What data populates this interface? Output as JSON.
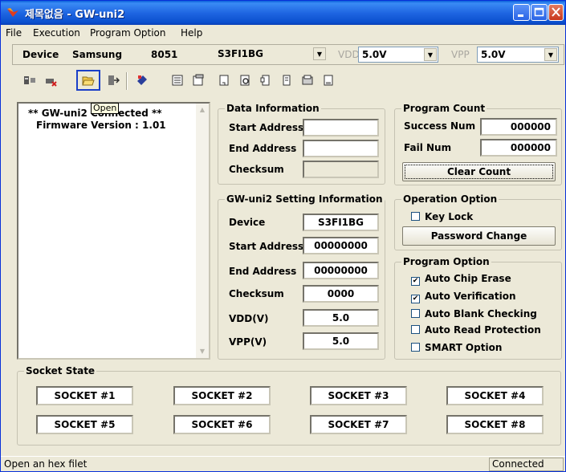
{
  "window": {
    "title": "제목없음 - GW-uni2"
  },
  "menu": {
    "file": "File",
    "execution": "Execution",
    "program_option": "Program Option",
    "help": "Help"
  },
  "device_bar": {
    "device_label": "Device",
    "maker": "Samsung",
    "core": "8051",
    "chip": "S3FI1BG",
    "vdd_label": "VDD",
    "vdd_value": "5.0V",
    "vpp_label": "VPP",
    "vpp_value": "5.0V"
  },
  "toolbar": {
    "tooltip": "Open",
    "active_tool": "open-icon"
  },
  "log": {
    "line1": "** GW-uni2 Connected **",
    "line2": "Firmware Version : 1.01"
  },
  "data_info": {
    "title": "Data Information",
    "start_label": "Start Address",
    "start_value": "",
    "end_label": "End Address",
    "end_value": "",
    "checksum_label": "Checksum",
    "checksum_value": ""
  },
  "setting_info": {
    "title": "GW-uni2 Setting Information",
    "device_label": "Device",
    "device_value": "S3FI1BG",
    "start_label": "Start Address",
    "start_value": "00000000",
    "end_label": "End Address",
    "end_value": "00000000",
    "checksum_label": "Checksum",
    "checksum_value": "0000",
    "vdd_label": "VDD(V)",
    "vdd_value": "5.0",
    "vpp_label": "VPP(V)",
    "vpp_value": "5.0"
  },
  "program_count": {
    "title": "Program Count",
    "success_label": "Success Num",
    "success_value": "000000",
    "fail_label": "Fail Num",
    "fail_value": "000000",
    "clear_label": "Clear Count"
  },
  "operation_option": {
    "title": "Operation Option",
    "key_lock": "Key Lock",
    "password": "Password Change"
  },
  "program_option": {
    "title": "Program Option",
    "auto_chip_erase": "Auto Chip Erase",
    "auto_verification": "Auto Verification",
    "auto_blank": "Auto Blank Checking",
    "auto_read_protection": "Auto Read Protection",
    "smart": "SMART Option"
  },
  "socket_state": {
    "title": "Socket State",
    "s1": "SOCKET #1",
    "s2": "SOCKET #2",
    "s3": "SOCKET #3",
    "s4": "SOCKET #4",
    "s5": "SOCKET #5",
    "s6": "SOCKET #6",
    "s7": "SOCKET #7",
    "s8": "SOCKET #8"
  },
  "status": {
    "left": "Open an hex filet",
    "right": "Connected"
  }
}
